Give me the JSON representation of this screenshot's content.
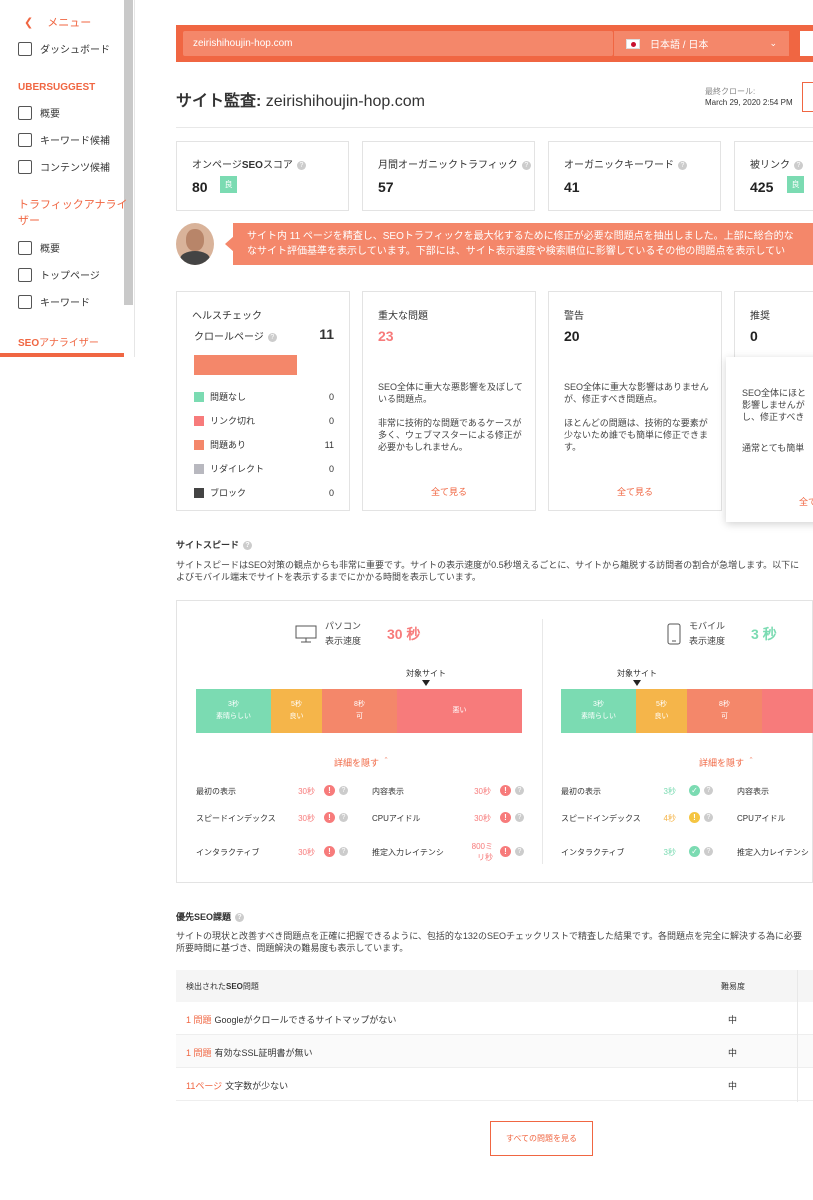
{
  "sidebar": {
    "menu_label": "メニュー",
    "dashboard": "ダッシュボード",
    "ubersuggest_heading": "UBERSUGGEST",
    "ubersuggest_items": [
      "概要",
      "キーワード候補",
      "コンテンツ候補"
    ],
    "traffic_heading": "トラフィックアナライザー",
    "traffic_items": [
      "概要",
      "トップページ",
      "キーワード"
    ],
    "seo_heading_bold": "SEO",
    "seo_heading_rest": "アナライザー"
  },
  "topbar": {
    "domain": "zeirishihoujin-hop.com",
    "language": "日本語 / 日本"
  },
  "header": {
    "title_prefix": "サイト監査: ",
    "title_domain": "zeirishihoujin-hop.com",
    "crawl_label": "最終クロール:",
    "crawl_date": "March 29, 2020 2:54 PM"
  },
  "metrics": [
    {
      "label_pre": "オンページ",
      "label_bold": "SEO",
      "label_post": "スコア",
      "value": "80",
      "badge": "良"
    },
    {
      "label_pre": "月間オーガニックトラフィック",
      "label_bold": "",
      "label_post": "",
      "value": "57",
      "badge": ""
    },
    {
      "label_pre": "オーガニックキーワード",
      "label_bold": "",
      "label_post": "",
      "value": "41",
      "badge": ""
    },
    {
      "label_pre": "被リンク",
      "label_bold": "",
      "label_post": "",
      "value": "425",
      "badge": "良"
    }
  ],
  "banner": {
    "line1": "サイト内 11 ページを精査し、SEOトラフィックを最大化するために修正が必要な問題点を抽出しました。上部に総合的な",
    "line2": "なサイト評価基準を表示しています。下部には、サイト表示速度や検索順位に影響しているその他の問題点を表示してい"
  },
  "health": {
    "title": "ヘルスチェック",
    "crawl_label": "クロールページ",
    "crawl_value": "11",
    "rows": [
      {
        "label": "問題なし",
        "count": "0",
        "color": "#7bdbb2"
      },
      {
        "label": "リンク切れ",
        "count": "0",
        "color": "#f77b7b"
      },
      {
        "label": "問題あり",
        "count": "11",
        "color": "#f4876a"
      },
      {
        "label": "リダイレクト",
        "count": "0",
        "color": "#b8b8bf"
      },
      {
        "label": "ブロック",
        "count": "0",
        "color": "#444444"
      }
    ]
  },
  "cards": [
    {
      "title": "重大な問題",
      "value": "23",
      "desc1": "SEO全体に重大な悪影響を及ぼしている問題点。",
      "desc2": "非常に技術的な問題であるケースが多く、ウェブマスターによる修正が必要かもしれません。",
      "link": "全て見る"
    },
    {
      "title": "警告",
      "value": "20",
      "desc1": "SEO全体に重大な影響はありませんが、修正すべき問題点。",
      "desc2": "ほとんどの問題は、技術的な要素が少ないため誰でも簡単に修正できます。",
      "link": "全て見る"
    },
    {
      "title": "推奨",
      "value": "0"
    }
  ],
  "popup": {
    "desc_lines": [
      "SEO全体にほと",
      "影響しませんが",
      "し、修正すべき"
    ],
    "desc2": "通常とても簡単",
    "link": "全て"
  },
  "site_speed": {
    "title": "サイトスピード",
    "line1": "サイトスピードはSEO対策の観点からも非常に重要です。サイトの表示速度が0.5秒増えるごとに、サイトから離脱する訪問者の割合が急増します。以下に",
    "line2": "よびモバイル端末でサイトを表示するまでにかかる時間を表示しています。",
    "target_label": "対象サイト",
    "detail_link": "詳細を隠す ＾",
    "desktop": {
      "name": "パソコン",
      "sub": "表示速度",
      "time": "30 秒",
      "time_color": "#f77b7b",
      "target_pos": 0.92
    },
    "mobile": {
      "name": "モバイル",
      "sub": "表示速度",
      "time": "3 秒",
      "time_color": "#7bdbb2",
      "target_pos": 0.2
    },
    "scale": [
      {
        "top": "3秒",
        "bottom": "素晴らしい",
        "color": "#7bdbb2"
      },
      {
        "top": "5秒",
        "bottom": "良い",
        "color": "#f5b54a"
      },
      {
        "top": "8秒",
        "bottom": "可",
        "color": "#f4876a"
      },
      {
        "top": "",
        "bottom": "悪い",
        "color": "#f77b7b"
      }
    ],
    "desktop_metrics": [
      {
        "label": "最初の表示",
        "value": "30秒",
        "status": "bad"
      },
      {
        "label": "内容表示",
        "value": "30秒",
        "status": "bad"
      },
      {
        "label": "スピードインデックス",
        "value": "30秒",
        "status": "bad"
      },
      {
        "label": "CPUアイドル",
        "value": "30秒",
        "status": "bad"
      },
      {
        "label": "インタラクティブ",
        "value": "30秒",
        "status": "bad"
      },
      {
        "label": "推定入力レイテンシ",
        "value": "800ミリ秒",
        "status": "bad"
      }
    ],
    "mobile_metrics": [
      {
        "label": "最初の表示",
        "value": "3秒",
        "status": "good"
      },
      {
        "label": "内容表示",
        "value": "",
        "status": ""
      },
      {
        "label": "スピードインデックス",
        "value": "4秒",
        "status": "warn"
      },
      {
        "label": "CPUアイドル",
        "value": "",
        "status": ""
      },
      {
        "label": "インタラクティブ",
        "value": "3秒",
        "status": "good"
      },
      {
        "label": "推定入力レイテンシ",
        "value": "",
        "status": ""
      }
    ]
  },
  "priority": {
    "title": "優先SEO課題",
    "line1": "サイトの現状と改善すべき問題点を正確に把握できるように、包括的な132のSEOチェックリストで精査した結果です。各問題点を完全に解決する為に必要",
    "line2": "所要時間に基づき、問題解決の難易度も表示しています。",
    "col_issue_pre": "検出された",
    "col_issue_bold": "SEO",
    "col_issue_post": "問題",
    "col_difficulty": "難易度",
    "rows": [
      {
        "count": "1 問題",
        "text": "Googleがクロールできるサイトマップがない",
        "difficulty": "中"
      },
      {
        "count": "1 問題",
        "text": "有効なSSL証明書が無い",
        "difficulty": "中"
      },
      {
        "count": "11ページ",
        "text": "文字数が少ない",
        "difficulty": "中"
      }
    ],
    "all_button": "すべての問題を見る"
  }
}
